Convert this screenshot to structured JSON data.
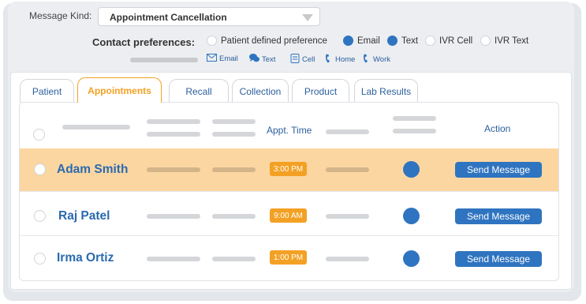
{
  "message_kind": {
    "label": "Message Kind:",
    "value": "Appointment Cancellation"
  },
  "contact_preferences": {
    "title": "Contact preferences:",
    "options": [
      {
        "label": "Patient defined preference",
        "selected": false
      },
      {
        "label": "Email",
        "selected": true
      },
      {
        "label": "Text",
        "selected": true
      },
      {
        "label": "IVR Cell",
        "selected": false
      },
      {
        "label": "IVR Text",
        "selected": false
      }
    ],
    "legend": [
      {
        "icon": "envelope-icon",
        "label": "Email"
      },
      {
        "icon": "chat-icon",
        "label": "Text"
      },
      {
        "icon": "cell-phone-icon",
        "label": "Cell"
      },
      {
        "icon": "phone-icon",
        "label": "Home"
      },
      {
        "icon": "phone-icon",
        "label": "Work"
      }
    ]
  },
  "tabs": [
    {
      "label": "Patient",
      "active": false
    },
    {
      "label": "Appointments",
      "active": true
    },
    {
      "label": "Recall",
      "active": false
    },
    {
      "label": "Collection",
      "active": false
    },
    {
      "label": "Product",
      "active": false
    },
    {
      "label": "Lab Results",
      "active": false
    }
  ],
  "table": {
    "headers": {
      "appt_time": "Appt. Time",
      "action": "Action"
    },
    "rows": [
      {
        "name": "Adam Smith",
        "time": "3:00 PM",
        "action": "Send Message",
        "highlighted": true
      },
      {
        "name": "Raj Patel",
        "time": "9:00 AM",
        "action": "Send Message",
        "highlighted": false
      },
      {
        "name": "Irma Ortiz",
        "time": "1:00 PM",
        "action": "Send Message",
        "highlighted": false
      }
    ]
  },
  "colors": {
    "accent": "#f3a124",
    "primary": "#2f74c0",
    "highlight_row": "#fbd6a1"
  }
}
